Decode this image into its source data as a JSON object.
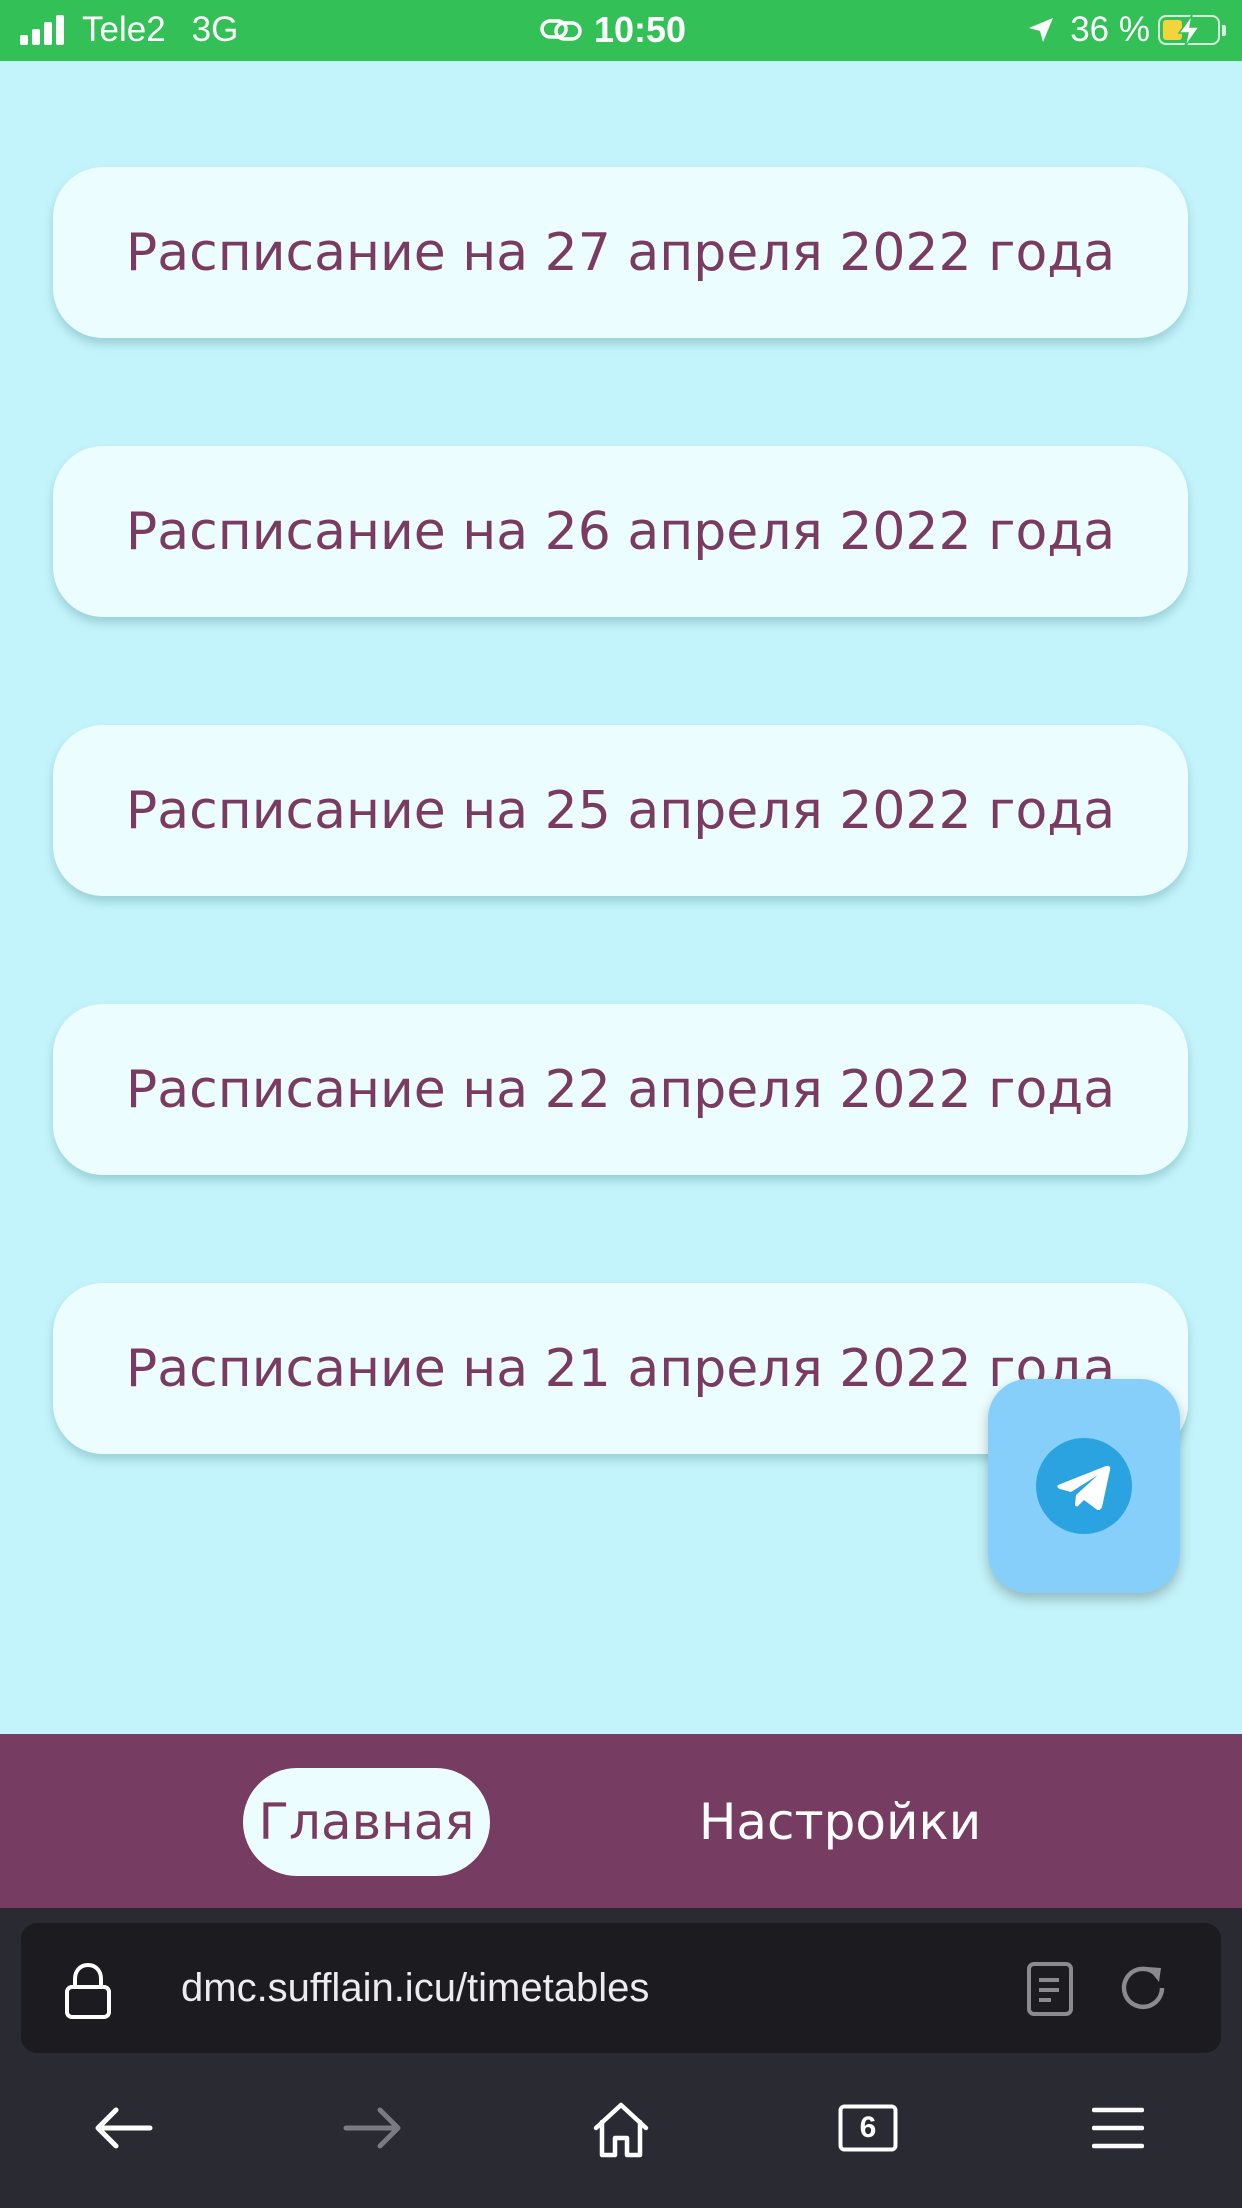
{
  "status_bar": {
    "carrier": "Tele2",
    "network": "3G",
    "time": "10:50",
    "battery": "36 %",
    "battery_level": 0.36,
    "icons": [
      "signal-icon",
      "link-icon",
      "location-arrow-icon",
      "battery-charging-icon"
    ]
  },
  "schedules": [
    {
      "label": "Расписание на 27 апреля 2022 года"
    },
    {
      "label": "Расписание на 26 апреля 2022 года"
    },
    {
      "label": "Расписание на 25 апреля 2022 года"
    },
    {
      "label": "Расписание на 22 апреля 2022 года"
    },
    {
      "label": "Расписание на 21 апреля 2022 года"
    }
  ],
  "fab": {
    "icon": "telegram-icon"
  },
  "nav": {
    "home_label": "Главная",
    "settings_label": "Настройки"
  },
  "browser": {
    "url": "dmc.sufflain.icu/timetables",
    "tabs_count": "6"
  },
  "colors": {
    "page_background": "#c4f4fb",
    "card_background": "#ebfdff",
    "card_text": "#7a3b63",
    "nav_background": "#773c61",
    "status_bar": "#33c157",
    "fab_background": "#86cffb",
    "telegram": "#2aa3e0"
  }
}
